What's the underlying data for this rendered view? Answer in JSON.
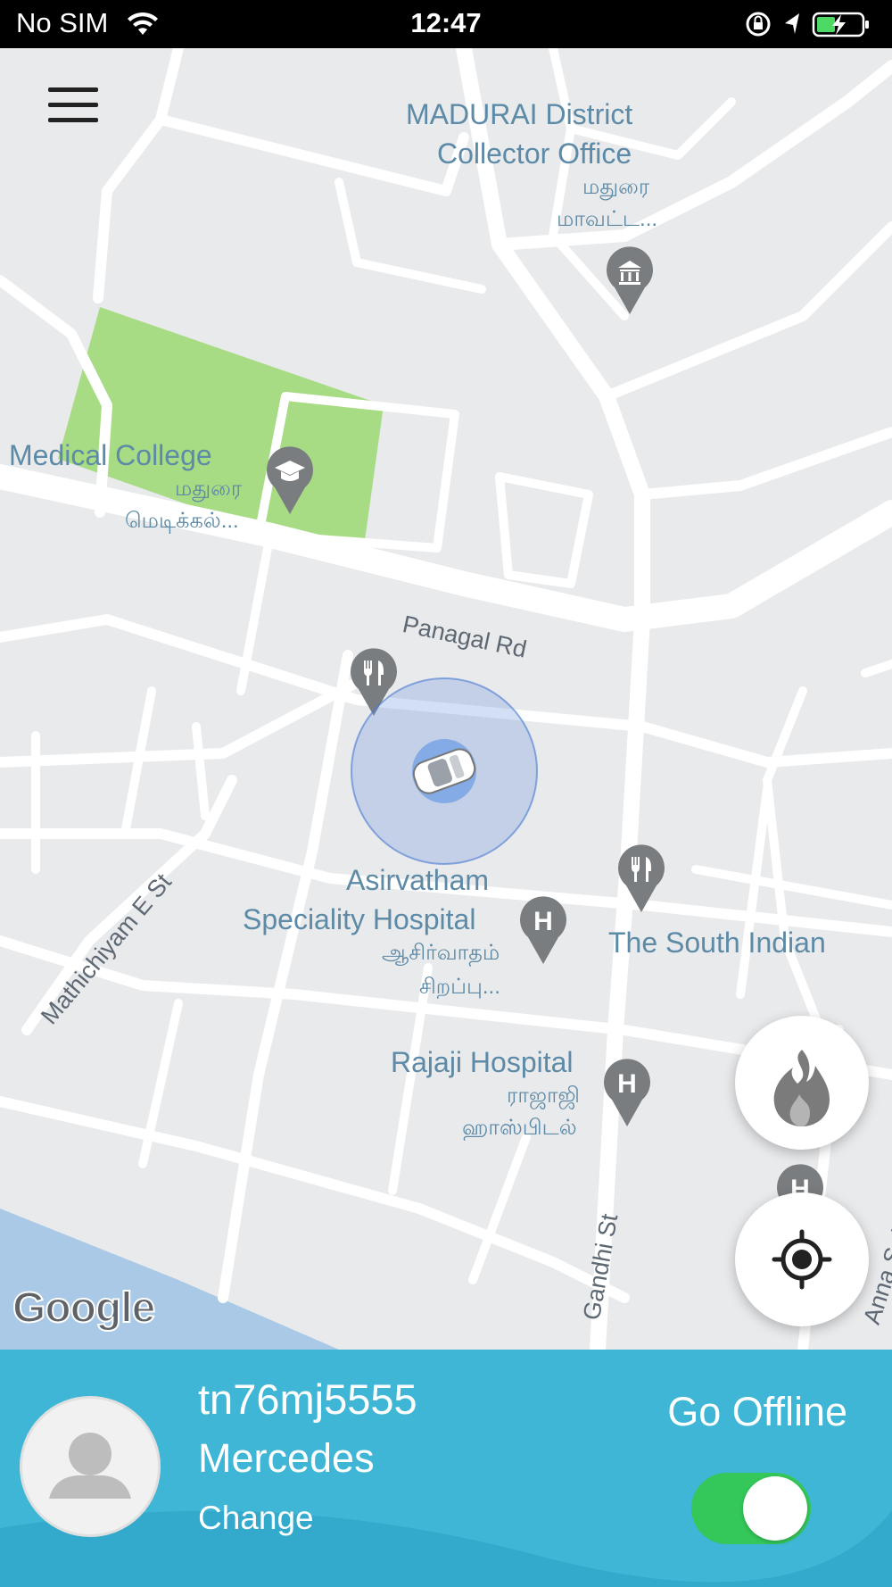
{
  "status_bar": {
    "carrier": "No SIM",
    "time": "12:47"
  },
  "map": {
    "labels": {
      "collector_office_line1": "MADURAI District",
      "collector_office_line2": "Collector Office",
      "collector_office_tamil1": "மதுரை",
      "collector_office_tamil2": "மாவட்ட...",
      "medical_college": "i Medical College",
      "medical_college_tamil1": "மதுரை",
      "medical_college_tamil2": "மெடிக்கல்...",
      "panagal_rd": "Panagal Rd",
      "mathichiyam": "Mathichiyam E St",
      "asirvatham_line1": "Asirvatham",
      "asirvatham_line2": "Speciality Hospital",
      "asirvatham_tamil1": "ஆசிர்வாதம்",
      "asirvatham_tamil2": "சிறப்பு...",
      "south_indian": "The South Indian",
      "rajaji_hospital": "Rajaji Hospital",
      "rajaji_tamil1": "ராஜாஜி",
      "rajaji_tamil2": "ஹாஸ்பிடல்",
      "gandhi_st": "Gandhi St",
      "anna_salai": "Anna Salai"
    },
    "google_logo": "Google",
    "hospital_pin_letter": "H"
  },
  "driver_panel": {
    "plate": "tn76mj5555",
    "model": "Mercedes",
    "change_label": "Change",
    "status_label": "Go Offline",
    "online": true
  },
  "icons": {
    "menu": "hamburger-menu-icon",
    "heatmap": "flame-icon",
    "recenter": "crosshair-location-icon",
    "car": "car-icon"
  },
  "colors": {
    "panel": "#3fb6d5",
    "toggle_on": "#34c759",
    "park": "#a8dc84",
    "water": "#a9c9e6",
    "label": "#5d8aa6"
  }
}
